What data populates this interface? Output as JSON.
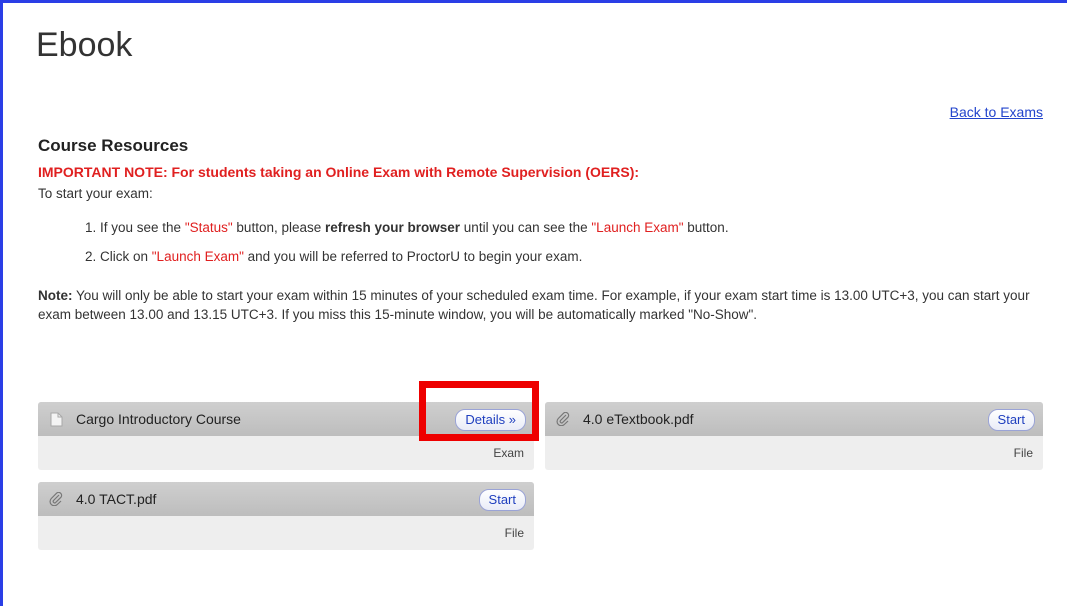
{
  "page": {
    "title": "Ebook"
  },
  "nav": {
    "back_link": "Back to Exams"
  },
  "resources": {
    "title": "Course Resources",
    "important": "IMPORTANT NOTE: For students taking an Online Exam with Remote Supervision (OERS):",
    "intro": "To start your exam:",
    "step1": {
      "a": "If you see the ",
      "status": "\"Status\"",
      "b": " button, please ",
      "bold": "refresh your browser",
      "c": " until you can see the ",
      "launch": "\"Launch Exam\"",
      "d": " button."
    },
    "step2": {
      "a": "Click on ",
      "launch": "\"Launch Exam\"",
      "b": " and you will be referred to ProctorU to begin your exam."
    },
    "note_label": "Note:",
    "note_text": " You will only be able to start your exam within 15 minutes of your scheduled exam time. For example, if your exam start time is 13.00 UTC+3, you can start your exam between 13.00 and 13.15 UTC+3. If you miss this 15-minute window, you will be automatically marked \"No-Show\"."
  },
  "tiles": [
    {
      "name": "Cargo Introductory Course",
      "button": "Details »",
      "type": "Exam",
      "icon": "document-icon"
    },
    {
      "name": "4.0 eTextbook.pdf",
      "button": "Start",
      "type": "File",
      "icon": "paperclip-icon"
    },
    {
      "name": "4.0 TACT.pdf",
      "button": "Start",
      "type": "File",
      "icon": "paperclip-icon"
    }
  ],
  "colors": {
    "frame": "#2a3ee6",
    "important": "#e02020",
    "highlight": "#ee0000",
    "link": "#2244cc"
  }
}
